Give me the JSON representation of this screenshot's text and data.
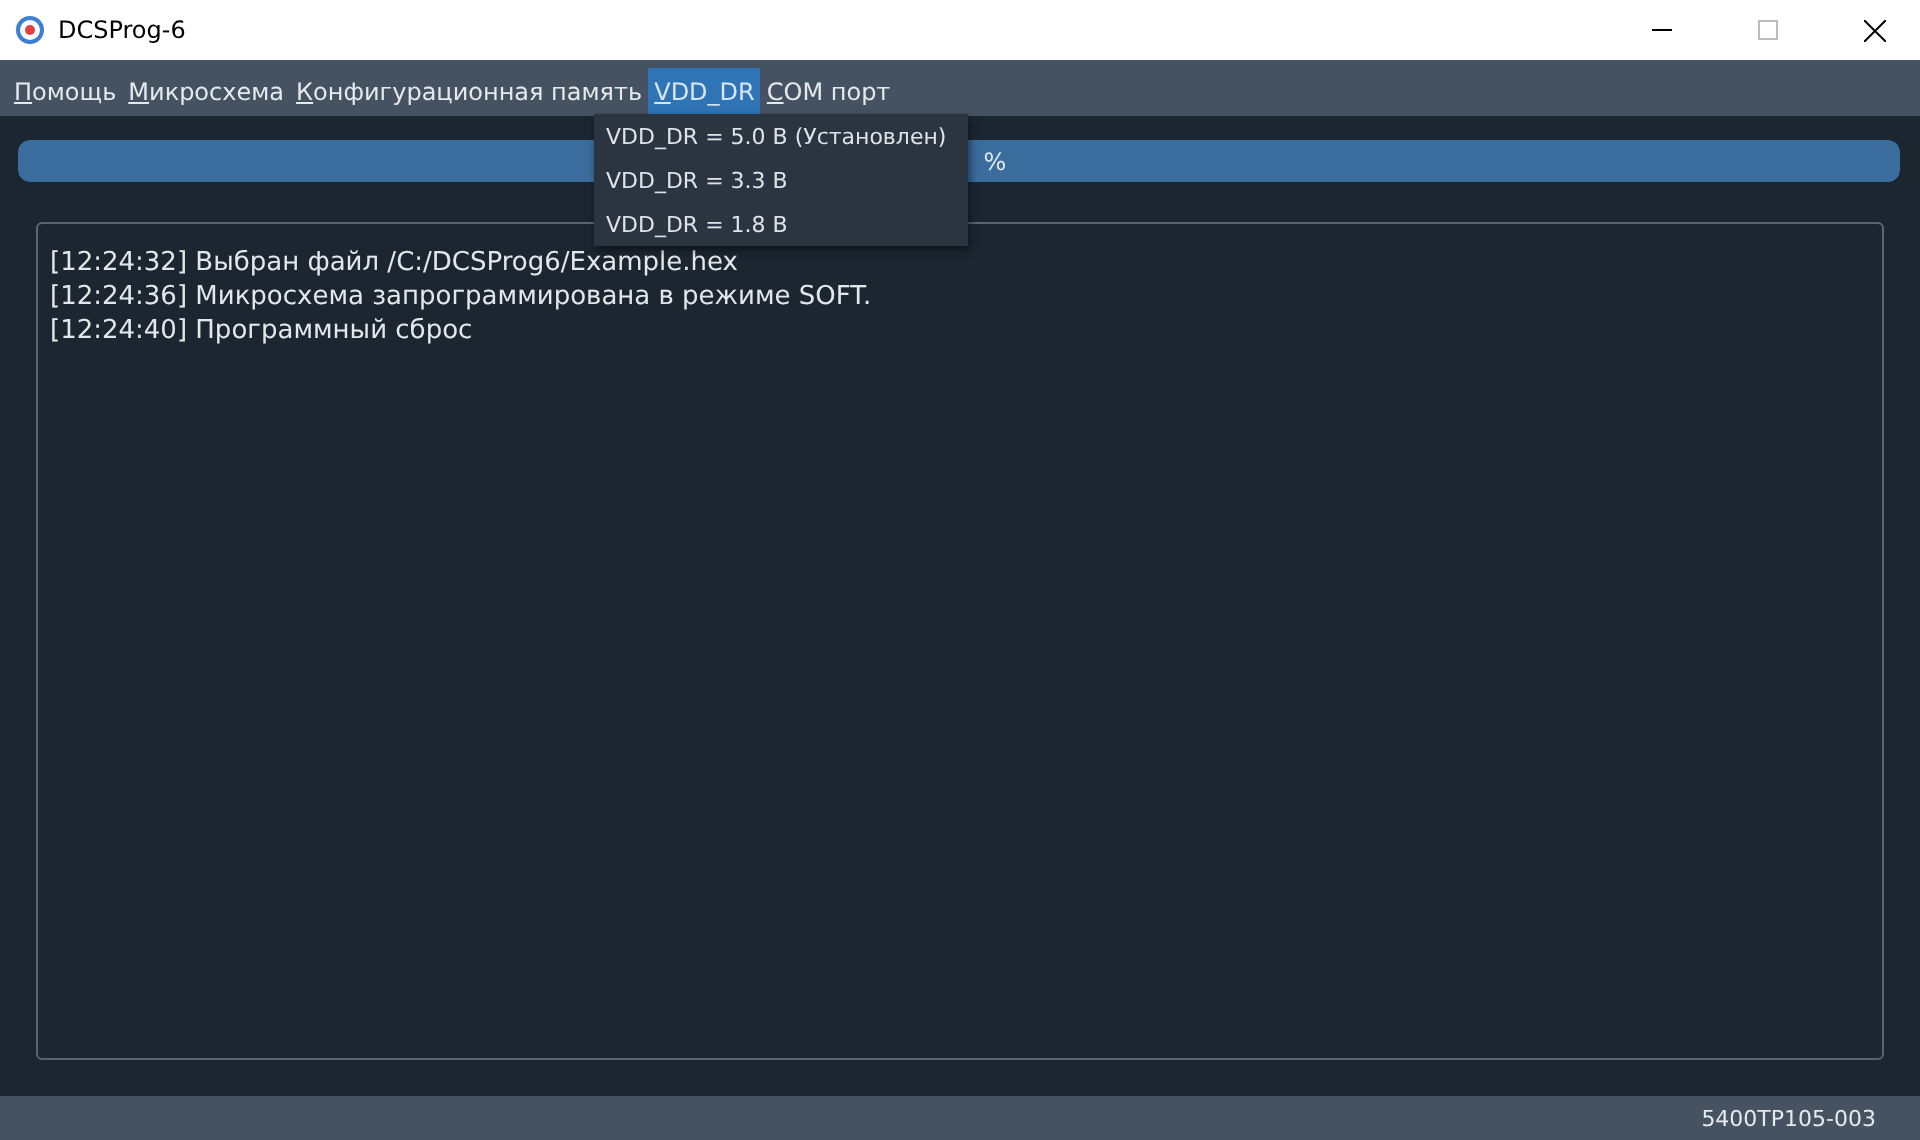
{
  "window": {
    "title": "DCSProg-6"
  },
  "menu": [
    {
      "label": "Помощь",
      "selected": false
    },
    {
      "label": "Микросхема",
      "selected": false
    },
    {
      "label": "Конфигурационная память",
      "selected": false
    },
    {
      "label": "VDD_DR",
      "selected": true
    },
    {
      "label": "COM порт",
      "selected": false
    }
  ],
  "dropdown": [
    "VDD_DR = 5.0 В (Установлен)",
    "VDD_DR = 3.3 В",
    "VDD_DR = 1.8 В"
  ],
  "progress": {
    "level": 1,
    "text": "%"
  },
  "log": [
    "[12:24:32] Выбран файл /C:/DCSProg6/Example.hex",
    "[12:24:36] Микросхема запрограммирована в режиме SOFT.",
    "[12:24:40] Программный сброс"
  ],
  "status_bar": "5400ТР105-003"
}
